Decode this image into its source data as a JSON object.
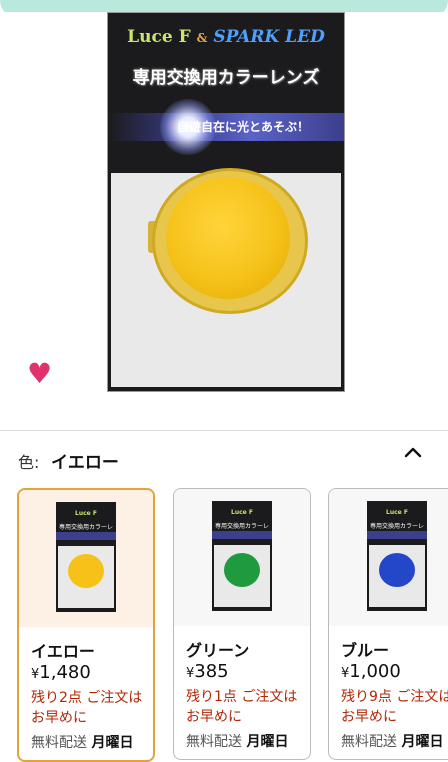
{
  "product": {
    "brand_luce": "Luce F",
    "brand_amp": "&",
    "brand_spark": "SPARK LED",
    "package_title": "専用交換用カラーレンズ",
    "package_tagline": "自遊自在に光とあそぶ！",
    "favorite_icon": "heart-icon",
    "favorite_color": "#e0336e"
  },
  "variant": {
    "label": "色:",
    "selected_value": "イエロー",
    "collapse_icon": "chevron-up-icon"
  },
  "options": [
    {
      "name": "イエロー",
      "price_symbol": "¥",
      "price": "1,480",
      "stock": "残り2点 ご注文はお早めに",
      "shipping_prefix": "無料配送",
      "shipping_day": "月曜日",
      "lens_color": "#f6c21a",
      "selected": true
    },
    {
      "name": "グリーン",
      "price_symbol": "¥",
      "price": "385",
      "stock": "残り1点 ご注文はお早めに",
      "shipping_prefix": "無料配送",
      "shipping_day": "月曜日",
      "lens_color": "#1f9a3e",
      "selected": false
    },
    {
      "name": "ブルー",
      "price_symbol": "¥",
      "price": "1,000",
      "stock": "残り9点 ご注文はお早めに",
      "shipping_prefix": "無料配送",
      "shipping_day": "月曜日",
      "lens_color": "#2446c8",
      "selected": false
    }
  ]
}
